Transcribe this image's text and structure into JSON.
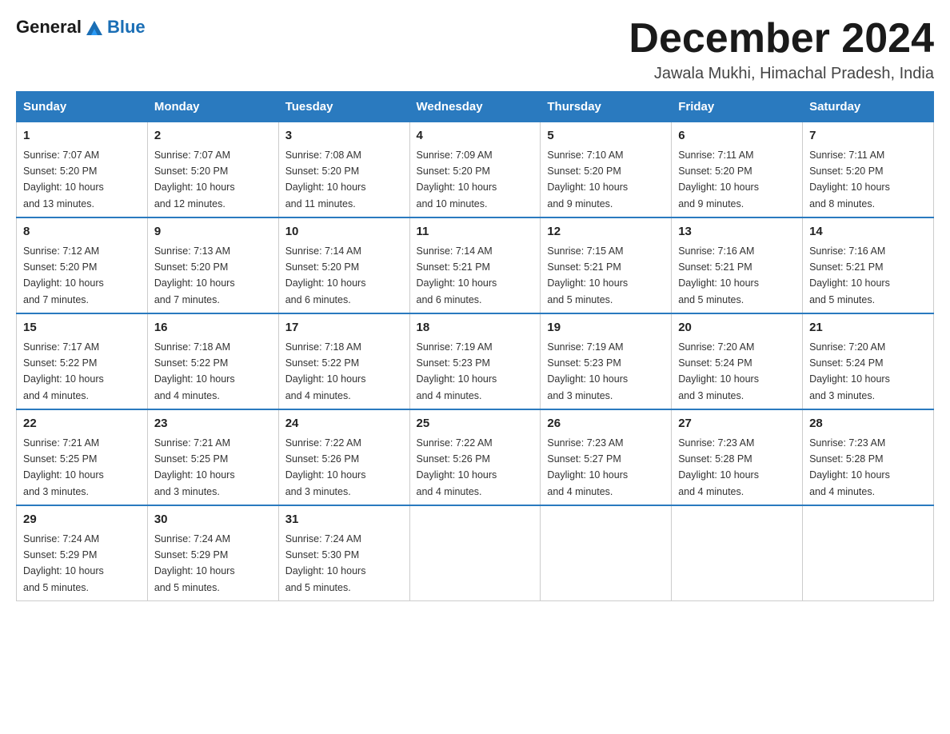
{
  "header": {
    "logo_general": "General",
    "logo_blue": "Blue",
    "month_title": "December 2024",
    "location": "Jawala Mukhi, Himachal Pradesh, India"
  },
  "days_of_week": [
    "Sunday",
    "Monday",
    "Tuesday",
    "Wednesday",
    "Thursday",
    "Friday",
    "Saturday"
  ],
  "weeks": [
    [
      {
        "day": "1",
        "sunrise": "7:07 AM",
        "sunset": "5:20 PM",
        "daylight": "10 hours and 13 minutes."
      },
      {
        "day": "2",
        "sunrise": "7:07 AM",
        "sunset": "5:20 PM",
        "daylight": "10 hours and 12 minutes."
      },
      {
        "day": "3",
        "sunrise": "7:08 AM",
        "sunset": "5:20 PM",
        "daylight": "10 hours and 11 minutes."
      },
      {
        "day": "4",
        "sunrise": "7:09 AM",
        "sunset": "5:20 PM",
        "daylight": "10 hours and 10 minutes."
      },
      {
        "day": "5",
        "sunrise": "7:10 AM",
        "sunset": "5:20 PM",
        "daylight": "10 hours and 9 minutes."
      },
      {
        "day": "6",
        "sunrise": "7:11 AM",
        "sunset": "5:20 PM",
        "daylight": "10 hours and 9 minutes."
      },
      {
        "day": "7",
        "sunrise": "7:11 AM",
        "sunset": "5:20 PM",
        "daylight": "10 hours and 8 minutes."
      }
    ],
    [
      {
        "day": "8",
        "sunrise": "7:12 AM",
        "sunset": "5:20 PM",
        "daylight": "10 hours and 7 minutes."
      },
      {
        "day": "9",
        "sunrise": "7:13 AM",
        "sunset": "5:20 PM",
        "daylight": "10 hours and 7 minutes."
      },
      {
        "day": "10",
        "sunrise": "7:14 AM",
        "sunset": "5:20 PM",
        "daylight": "10 hours and 6 minutes."
      },
      {
        "day": "11",
        "sunrise": "7:14 AM",
        "sunset": "5:21 PM",
        "daylight": "10 hours and 6 minutes."
      },
      {
        "day": "12",
        "sunrise": "7:15 AM",
        "sunset": "5:21 PM",
        "daylight": "10 hours and 5 minutes."
      },
      {
        "day": "13",
        "sunrise": "7:16 AM",
        "sunset": "5:21 PM",
        "daylight": "10 hours and 5 minutes."
      },
      {
        "day": "14",
        "sunrise": "7:16 AM",
        "sunset": "5:21 PM",
        "daylight": "10 hours and 5 minutes."
      }
    ],
    [
      {
        "day": "15",
        "sunrise": "7:17 AM",
        "sunset": "5:22 PM",
        "daylight": "10 hours and 4 minutes."
      },
      {
        "day": "16",
        "sunrise": "7:18 AM",
        "sunset": "5:22 PM",
        "daylight": "10 hours and 4 minutes."
      },
      {
        "day": "17",
        "sunrise": "7:18 AM",
        "sunset": "5:22 PM",
        "daylight": "10 hours and 4 minutes."
      },
      {
        "day": "18",
        "sunrise": "7:19 AM",
        "sunset": "5:23 PM",
        "daylight": "10 hours and 4 minutes."
      },
      {
        "day": "19",
        "sunrise": "7:19 AM",
        "sunset": "5:23 PM",
        "daylight": "10 hours and 3 minutes."
      },
      {
        "day": "20",
        "sunrise": "7:20 AM",
        "sunset": "5:24 PM",
        "daylight": "10 hours and 3 minutes."
      },
      {
        "day": "21",
        "sunrise": "7:20 AM",
        "sunset": "5:24 PM",
        "daylight": "10 hours and 3 minutes."
      }
    ],
    [
      {
        "day": "22",
        "sunrise": "7:21 AM",
        "sunset": "5:25 PM",
        "daylight": "10 hours and 3 minutes."
      },
      {
        "day": "23",
        "sunrise": "7:21 AM",
        "sunset": "5:25 PM",
        "daylight": "10 hours and 3 minutes."
      },
      {
        "day": "24",
        "sunrise": "7:22 AM",
        "sunset": "5:26 PM",
        "daylight": "10 hours and 3 minutes."
      },
      {
        "day": "25",
        "sunrise": "7:22 AM",
        "sunset": "5:26 PM",
        "daylight": "10 hours and 4 minutes."
      },
      {
        "day": "26",
        "sunrise": "7:23 AM",
        "sunset": "5:27 PM",
        "daylight": "10 hours and 4 minutes."
      },
      {
        "day": "27",
        "sunrise": "7:23 AM",
        "sunset": "5:28 PM",
        "daylight": "10 hours and 4 minutes."
      },
      {
        "day": "28",
        "sunrise": "7:23 AM",
        "sunset": "5:28 PM",
        "daylight": "10 hours and 4 minutes."
      }
    ],
    [
      {
        "day": "29",
        "sunrise": "7:24 AM",
        "sunset": "5:29 PM",
        "daylight": "10 hours and 5 minutes."
      },
      {
        "day": "30",
        "sunrise": "7:24 AM",
        "sunset": "5:29 PM",
        "daylight": "10 hours and 5 minutes."
      },
      {
        "day": "31",
        "sunrise": "7:24 AM",
        "sunset": "5:30 PM",
        "daylight": "10 hours and 5 minutes."
      },
      null,
      null,
      null,
      null
    ]
  ],
  "labels": {
    "sunrise": "Sunrise:",
    "sunset": "Sunset:",
    "daylight": "Daylight:"
  }
}
